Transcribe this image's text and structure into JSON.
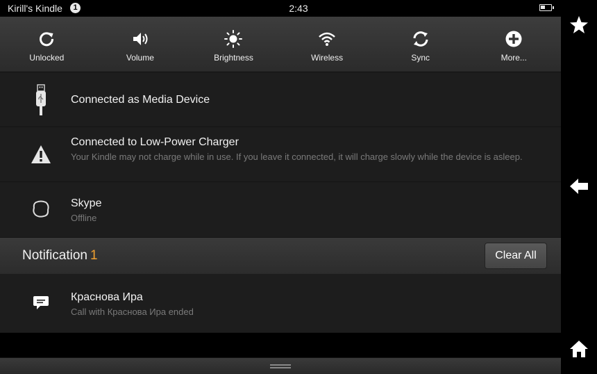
{
  "status_bar": {
    "device_name": "Kirill's Kindle",
    "notification_count": "1",
    "time": "2:43"
  },
  "quick_settings": [
    {
      "label": "Unlocked",
      "icon": "rotation-unlocked-icon"
    },
    {
      "label": "Volume",
      "icon": "volume-icon"
    },
    {
      "label": "Brightness",
      "icon": "brightness-icon"
    },
    {
      "label": "Wireless",
      "icon": "wifi-icon"
    },
    {
      "label": "Sync",
      "icon": "sync-icon"
    },
    {
      "label": "More...",
      "icon": "plus-icon"
    }
  ],
  "connections": [
    {
      "title": "Connected as Media Device",
      "subtitle": "",
      "icon": "usb-icon"
    },
    {
      "title": "Connected to Low-Power Charger",
      "subtitle": "Your Kindle may not charge while in use. If you leave it connected, it will charge slowly while the device is asleep.",
      "icon": "warning-icon"
    },
    {
      "title": "Skype",
      "subtitle": "Offline",
      "icon": "skype-icon"
    }
  ],
  "notifications": {
    "header_label": "Notification",
    "count": "1",
    "clear_all_label": "Clear All",
    "items": [
      {
        "title": "Краснова Ира",
        "subtitle": "Call with Краснова Ира ended",
        "icon": "chat-bubble-icon"
      }
    ]
  },
  "nav": [
    "star-icon",
    "back-arrow-icon",
    "home-icon"
  ],
  "colors": {
    "accent": "#f0a030",
    "panel": "#1d1d1d",
    "header": "#333333"
  }
}
